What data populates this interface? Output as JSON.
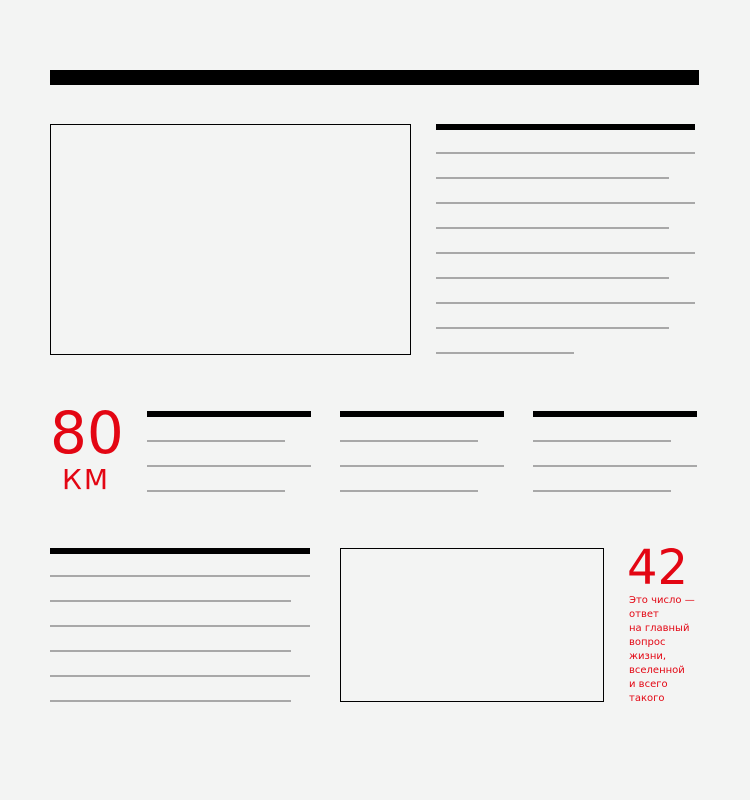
{
  "stat_distance": {
    "value": "80",
    "unit": "КМ"
  },
  "stat_answer": {
    "value": "42",
    "caption_lines": [
      "Это число —",
      "ответ",
      "на главный",
      "вопрос",
      "жизни,",
      "вселенной",
      "и всего",
      "такого"
    ]
  },
  "colors": {
    "accent": "#e30613",
    "ink": "#000000",
    "placeholder_line": "#a8a8a8",
    "background": "#f3f4f3"
  }
}
